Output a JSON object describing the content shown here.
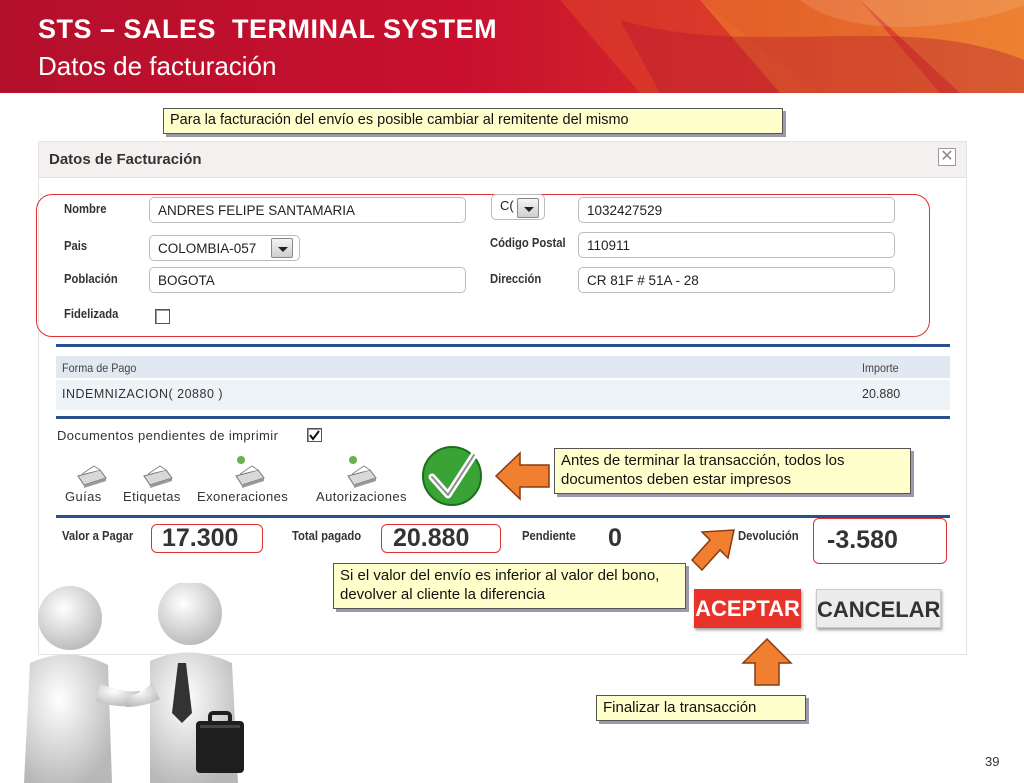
{
  "slide": {
    "title": "STS – SALES  TERMINAL SYSTEM",
    "subtitle": "Datos de facturación",
    "page_number": "39"
  },
  "callouts": {
    "top": "Para la facturación del envío es posible cambiar al remitente del mismo",
    "docs": "Antes de terminar la transacción, todos los documentos deben estar impresos",
    "refund": "Si el valor del envío es inferior al valor del bono, devolver  al cliente la diferencia",
    "finish": "Finalizar la transacción"
  },
  "dialog": {
    "title": "Datos de Facturación",
    "close": "✕",
    "fields": {
      "nombre_label": "Nombre",
      "nombre_value": "ANDRES FELIPE SANTAMARIA",
      "doc_type_value": "C(",
      "doc_number_value": "1032427529",
      "pais_label": "Pais",
      "pais_value": "COLOMBIA-057",
      "codigo_postal_label": "Código Postal",
      "codigo_postal_value": "110911",
      "poblacion_label": "Población",
      "poblacion_value": "BOGOTA",
      "direccion_label": "Dirección",
      "direccion_value": "CR 81F # 51A - 28",
      "fidelizada_label": "Fidelizada"
    },
    "payment": {
      "headers": [
        "Forma de Pago",
        "Importe"
      ],
      "rows": [
        {
          "forma": "INDEMNIZACION( 20880 )",
          "importe": "20.880"
        }
      ]
    },
    "documents": {
      "pending_label": "Documentos pendientes de imprimir",
      "items": [
        "Guías",
        "Etiquetas",
        "Exoneraciones",
        "Autorizaciones"
      ]
    },
    "totals": {
      "valor_label": "Valor a Pagar",
      "valor_value": "17.300",
      "total_label": "Total pagado",
      "total_value": "20.880",
      "pendiente_label": "Pendiente",
      "pendiente_value": "0",
      "devolucion_label": "Devolución",
      "devolucion_value": "-3.580"
    },
    "buttons": {
      "accept": "ACEPTAR",
      "cancel": "CANCELAR"
    }
  },
  "colors": {
    "brand_red": "#c8102e",
    "accept_red": "#e8332a",
    "arrow_orange": "#f08030",
    "table_blue": "#2a4f8f",
    "check_green": "#3aa335"
  }
}
